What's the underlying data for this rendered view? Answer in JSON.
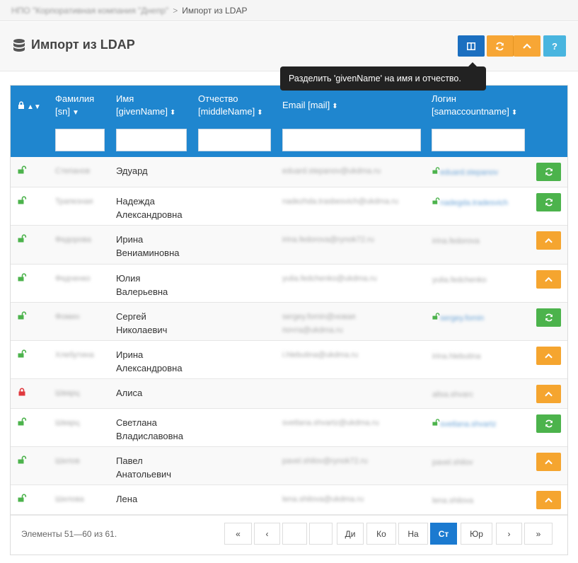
{
  "breadcrumb": {
    "parent": "НПО \"Корпоративная компания \"Днепр\"",
    "separator": ">",
    "current": "Импорт из LDAP"
  },
  "page": {
    "title": "Импорт из LDAP",
    "tooltip": "Разделить 'givenName' на имя и отчество."
  },
  "toolbar": {
    "help_label": "?"
  },
  "table": {
    "headers": {
      "lastname": [
        "Фамилия",
        "[sn]"
      ],
      "firstname": [
        "Имя",
        "[givenName]"
      ],
      "middlename": [
        "Отчество",
        "[middleName]"
      ],
      "email": [
        "Email [mail]"
      ],
      "login": [
        "Логин",
        "[samaccountname]"
      ]
    },
    "rows": [
      {
        "locked": false,
        "lastname": "Степанов",
        "firstname": [
          "Эдуард"
        ],
        "email": [
          "eduard.stepanov@ukdma.ru"
        ],
        "login": [
          "eduard.stepanov"
        ],
        "login_linked": true,
        "action": "sync"
      },
      {
        "locked": false,
        "lastname": "Трапезная",
        "firstname": [
          "Надежда",
          "Александровна"
        ],
        "email": [
          "nadezhda.trasbesvich@ukdma.ru"
        ],
        "login": [
          "nadegda.tradesvich"
        ],
        "login_linked": true,
        "action": "sync"
      },
      {
        "locked": false,
        "lastname": "Федорова",
        "firstname": [
          "Ирина",
          "Вениаминовна"
        ],
        "email": [
          "irina.fedorova@rynok72.ru"
        ],
        "login": [
          "irina.fedorova"
        ],
        "login_linked": false,
        "action": "up"
      },
      {
        "locked": false,
        "lastname": "Федченко",
        "firstname": [
          "Юлия",
          "Валерьевна"
        ],
        "email": [
          "yulia.fedchenko@ukdma.ru"
        ],
        "login": [
          "yulia.fedchenko"
        ],
        "login_linked": false,
        "action": "up"
      },
      {
        "locked": false,
        "lastname": "Фомин",
        "firstname": [
          "Сергей",
          "Николаевич"
        ],
        "email": [
          "sergey.fomin@новая",
          "почта@ukdma.ru"
        ],
        "login": [
          "sergey.fomin"
        ],
        "login_linked": true,
        "action": "sync"
      },
      {
        "locked": false,
        "lastname": "Хлебутина",
        "firstname": [
          "Ирина",
          "Александровна"
        ],
        "email": [
          "i.hlebutina@ukdma.ru"
        ],
        "login": [
          "irina.hlebutina"
        ],
        "login_linked": false,
        "action": "up"
      },
      {
        "locked": true,
        "lastname": "Шварц",
        "firstname": [
          "Алиса"
        ],
        "email": [
          ""
        ],
        "login": [
          "alisa.shvarc"
        ],
        "login_linked": false,
        "action": "up"
      },
      {
        "locked": false,
        "lastname": "Шварц",
        "firstname": [
          "Светлана",
          "Владиславовна"
        ],
        "email": [
          "svetlana.shvartz@ukdma.ru"
        ],
        "login": [
          "svetlana.shvartz"
        ],
        "login_linked": true,
        "action": "sync"
      },
      {
        "locked": false,
        "lastname": "Шилов",
        "firstname": [
          "Павел",
          "Анатольевич"
        ],
        "email": [
          "pavel.shilov@rynok72.ru"
        ],
        "login": [
          "pavel.shilov"
        ],
        "login_linked": false,
        "action": "up"
      },
      {
        "locked": false,
        "lastname": "Шилова",
        "firstname": [
          "Лена"
        ],
        "email": [
          "lena.shilova@ukdma.ru"
        ],
        "login": [
          "lena.shilova"
        ],
        "login_linked": false,
        "action": "up"
      }
    ]
  },
  "footer": {
    "info": "Элементы 51—60 из 61.",
    "pages": [
      {
        "label": "«",
        "active": false
      },
      {
        "label": "‹",
        "active": false
      },
      {
        "label": "",
        "active": false
      },
      {
        "label": "",
        "active": false
      },
      {
        "label": "Ди",
        "active": false
      },
      {
        "label": "Ко",
        "active": false
      },
      {
        "label": "На",
        "active": false
      },
      {
        "label": "Ст",
        "active": true
      },
      {
        "label": "Юр",
        "active": false
      },
      {
        "label": "›",
        "active": false
      },
      {
        "label": "»",
        "active": false
      }
    ]
  },
  "colors": {
    "header": "#1f86cf",
    "primary": "#1b6fc0",
    "warning": "#f7a635",
    "success": "#4cb34c",
    "info": "#49b5df",
    "danger": "#e0393e"
  }
}
